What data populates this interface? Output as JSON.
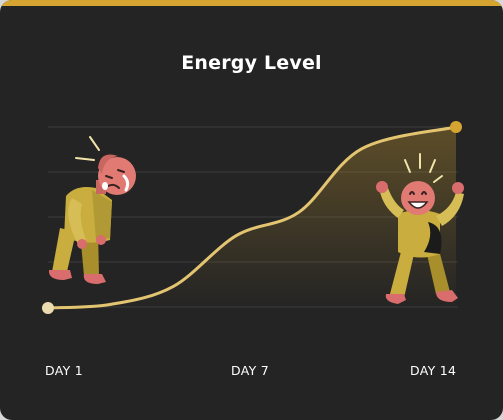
{
  "card": {
    "accent_color": "#d6a531",
    "background": "#242424"
  },
  "chart_data": {
    "type": "line",
    "title": "Energy Level",
    "x": [
      1,
      3,
      5,
      7,
      9,
      11,
      14
    ],
    "values": [
      0,
      2,
      12,
      40,
      53,
      88,
      100
    ],
    "categories": [
      "DAY 1",
      "DAY 7",
      "DAY 14"
    ],
    "xlim": [
      1,
      14
    ],
    "ylim": [
      0,
      100
    ],
    "grid": true,
    "line_color": "#e3c471",
    "start_dot_color": "#eadcae",
    "end_dot_color": "#d6a531"
  },
  "illustrations": {
    "start": "tired-person-icon",
    "end": "energetic-person-icon"
  }
}
